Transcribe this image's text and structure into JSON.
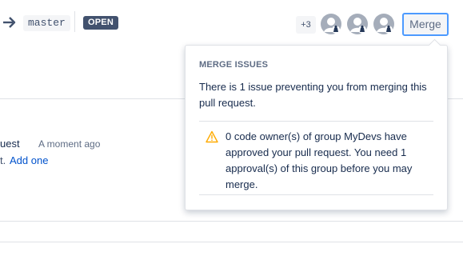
{
  "header": {
    "target_branch": "master",
    "status_badge": "OPEN",
    "reviewers_more": "+3",
    "merge_label": "Merge"
  },
  "background": {
    "activity_title": "uest",
    "activity_time": "A moment ago",
    "description_prefix": "t.",
    "add_link": "Add one"
  },
  "merge_issues": {
    "heading": "MERGE ISSUES",
    "summary": "There is 1 issue preventing you from merging this pull request.",
    "issue": "0 code owner(s) of group MyDevs have approved your pull request. You need 1 approval(s) of this group before you may merge."
  },
  "icons": {
    "arrow": "arrow-right-icon",
    "avatar": "default-avatar-icon",
    "warning": "warning-icon"
  },
  "colors": {
    "badge_bg": "#42526e",
    "merge_border": "#4c9aff",
    "link": "#0052cc",
    "warning": "#ffab00"
  }
}
